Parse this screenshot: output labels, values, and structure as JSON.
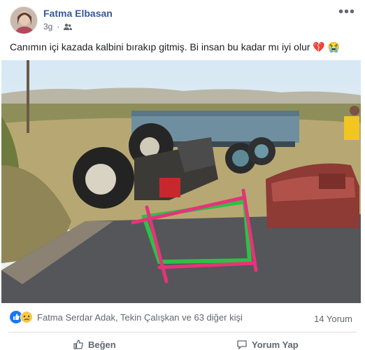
{
  "author": {
    "name": "Fatma Elbasan"
  },
  "meta": {
    "time": "3g",
    "privacy_icon": "friends-icon"
  },
  "post": {
    "text": "Canımın içi kazada kalbini bırakıp gitmiş. Bi insan bu kadar mı iyi olur 💔 😭"
  },
  "reactions": {
    "names": "Fatma Serdar Adak, Tekin Çalışkan ve 63 diğer kişi",
    "icons": [
      "like-icon",
      "sad-icon"
    ]
  },
  "comments": {
    "count": "14 Yorum"
  },
  "actions": {
    "like": "Beğen",
    "comment": "Yorum Yap"
  },
  "colors": {
    "link": "#385898",
    "accent": "#1877f2"
  }
}
